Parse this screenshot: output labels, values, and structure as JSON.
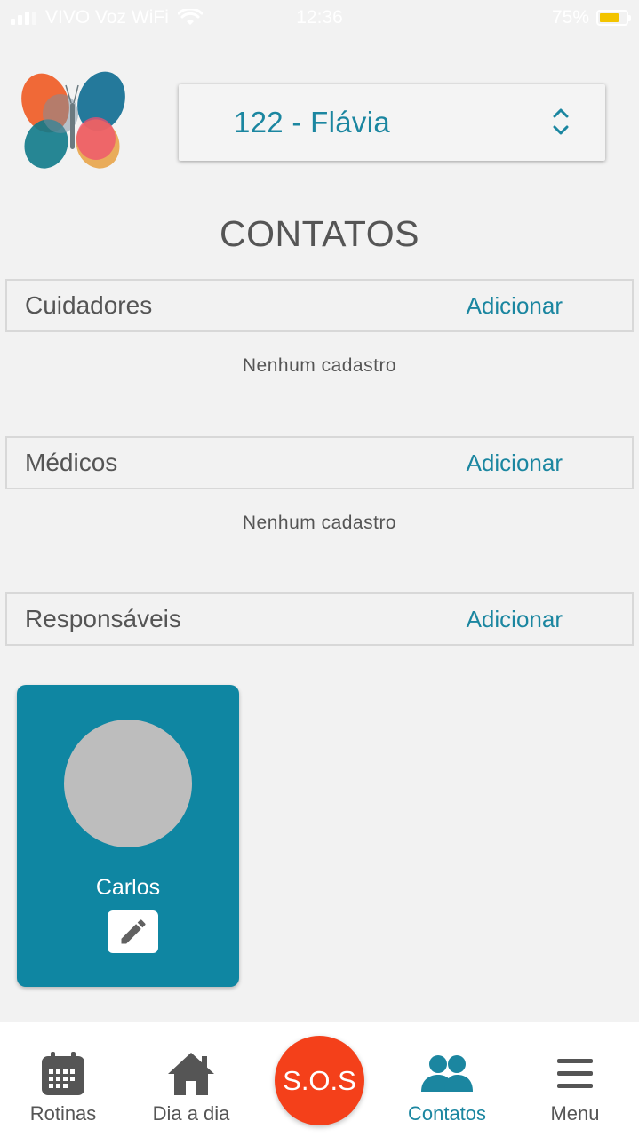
{
  "status_bar": {
    "carrier": "VIVO Voz WiFi",
    "time": "12:36",
    "battery": "75%",
    "wifi_icon": "wifi-icon",
    "battery_level": 0.75
  },
  "header": {
    "logo": "butterfly-logo",
    "patient_selected": "122 - Flávia"
  },
  "page": {
    "title": "CONTATOS"
  },
  "sections": [
    {
      "title": "Cuidadores",
      "add_label": "Adicionar",
      "empty_text": "Nenhum cadastro"
    },
    {
      "title": "Médicos",
      "add_label": "Adicionar",
      "empty_text": "Nenhum cadastro"
    },
    {
      "title": "Responsáveis",
      "add_label": "Adicionar",
      "empty_text": ""
    }
  ],
  "contacts": [
    {
      "name": "Carlos",
      "edit_icon": "pencil-icon"
    }
  ],
  "bottom_nav": {
    "items": [
      {
        "label": "Rotinas",
        "icon": "calendar-icon"
      },
      {
        "label": "Dia a dia",
        "icon": "home-icon"
      },
      {
        "label": "Contatos",
        "icon": "people-icon"
      },
      {
        "label": "Menu",
        "icon": "hamburger-icon"
      }
    ],
    "sos_label": "S.O.S",
    "active": "Contatos"
  },
  "colors": {
    "accent": "#1b86a0",
    "card": "#0f86a2",
    "sos": "#f4401a",
    "background": "#f2f2f2"
  }
}
